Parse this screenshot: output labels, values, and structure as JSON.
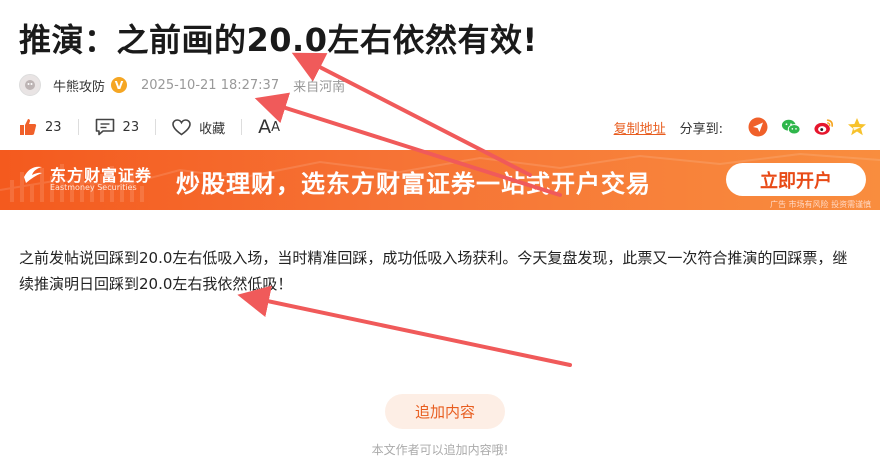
{
  "article": {
    "title": "推演：之前画的20.0左右依然有效!",
    "author": "牛熊攻防",
    "verified_badge": "V",
    "time": "2025-10-21 18:27:37",
    "from": "来自河南",
    "content": "之前发帖说回踩到20.0左右低吸入场，当时精准回踩，成功低吸入场获利。今天复盘发现，此票又一次符合推演的回踩票，继续推演明日回踩到20.0左右我依然低吸！"
  },
  "actions": {
    "like_count": "23",
    "comment_count": "23",
    "favorite_label": "收藏",
    "font_size_label": "A",
    "font_size_small": "A",
    "copy_link": "复制地址",
    "share_label": "分享到:"
  },
  "banner": {
    "brand": "东方财富证券",
    "brand_en": "Eastmoney Securities",
    "slogan": "炒股理财，选东方财富证券一站式开户交易",
    "button": "立即开户",
    "ad_note": "广告 市场有风险 投资需谨慎"
  },
  "footer": {
    "add_button": "追加内容",
    "note": "本文作者可以追加内容哦!"
  },
  "colors": {
    "accent": "#e85d1f",
    "annotation_arrow": "#f05a5a",
    "banner_start": "#f45a1e",
    "banner_end": "#f98d3e"
  },
  "icons": [
    "thumbs-up-icon",
    "comment-icon",
    "heart-icon",
    "font-size-icon",
    "share-toutiao-icon",
    "wechat-icon",
    "weibo-icon",
    "qzone-star-icon"
  ]
}
